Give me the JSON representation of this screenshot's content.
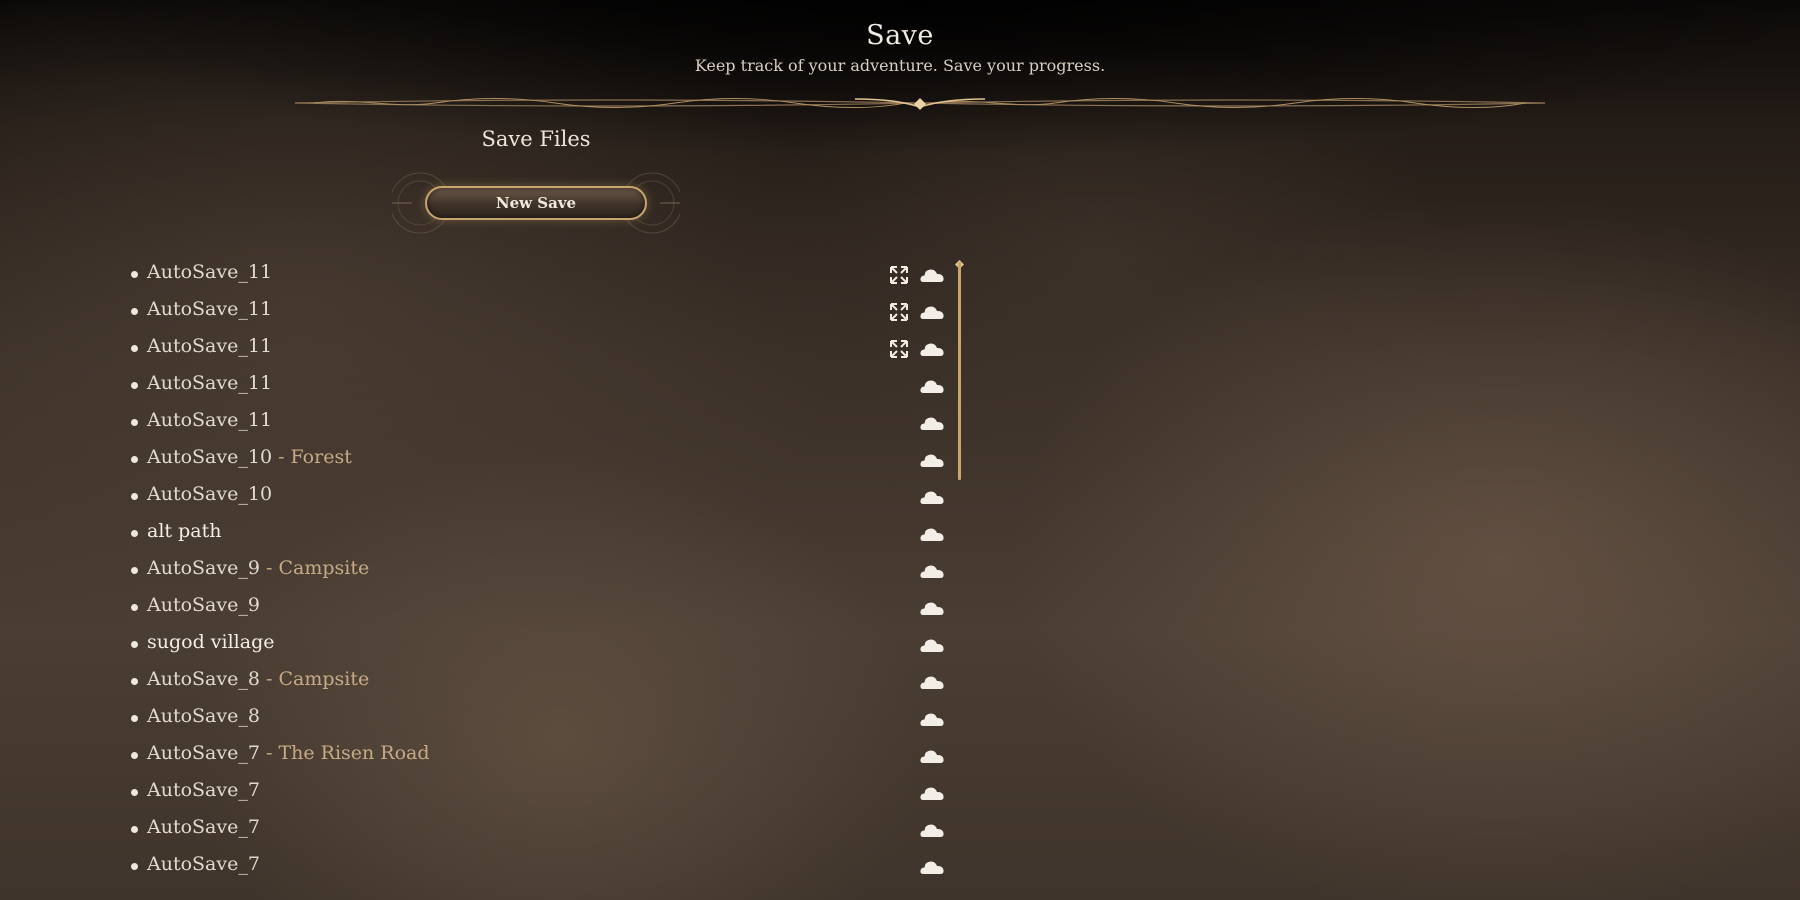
{
  "header": {
    "title": "Save",
    "subtitle": "Keep track of your adventure. Save your progress."
  },
  "save_files": {
    "section_title": "Save Files",
    "new_save_label": "New Save",
    "items": [
      {
        "name": "AutoSave_11",
        "location": "",
        "expand_icon": true,
        "cloud_icon": true,
        "kind": "auto"
      },
      {
        "name": "AutoSave_11",
        "location": "",
        "expand_icon": true,
        "cloud_icon": true,
        "kind": "auto"
      },
      {
        "name": "AutoSave_11",
        "location": "",
        "expand_icon": true,
        "cloud_icon": true,
        "kind": "auto"
      },
      {
        "name": "AutoSave_11",
        "location": "",
        "expand_icon": false,
        "cloud_icon": true,
        "kind": "auto"
      },
      {
        "name": "AutoSave_11",
        "location": "",
        "expand_icon": false,
        "cloud_icon": true,
        "kind": "auto"
      },
      {
        "name": "AutoSave_10",
        "location": " - Forest",
        "expand_icon": false,
        "cloud_icon": true,
        "kind": "auto"
      },
      {
        "name": "AutoSave_10",
        "location": "",
        "expand_icon": false,
        "cloud_icon": true,
        "kind": "auto"
      },
      {
        "name": "alt path",
        "location": "",
        "expand_icon": false,
        "cloud_icon": true,
        "kind": "user"
      },
      {
        "name": "AutoSave_9",
        "location": " - Campsite",
        "expand_icon": false,
        "cloud_icon": true,
        "kind": "auto"
      },
      {
        "name": "AutoSave_9",
        "location": "",
        "expand_icon": false,
        "cloud_icon": true,
        "kind": "auto"
      },
      {
        "name": "sugod village",
        "location": "",
        "expand_icon": false,
        "cloud_icon": true,
        "kind": "user"
      },
      {
        "name": "AutoSave_8",
        "location": " - Campsite",
        "expand_icon": false,
        "cloud_icon": true,
        "kind": "auto"
      },
      {
        "name": "AutoSave_8",
        "location": "",
        "expand_icon": false,
        "cloud_icon": true,
        "kind": "auto"
      },
      {
        "name": "AutoSave_7",
        "location": " - The Risen Road",
        "expand_icon": false,
        "cloud_icon": true,
        "kind": "auto"
      },
      {
        "name": "AutoSave_7",
        "location": "",
        "expand_icon": false,
        "cloud_icon": true,
        "kind": "auto"
      },
      {
        "name": "AutoSave_7",
        "location": "",
        "expand_icon": false,
        "cloud_icon": true,
        "kind": "auto"
      },
      {
        "name": "AutoSave_7",
        "location": "",
        "expand_icon": false,
        "cloud_icon": true,
        "kind": "auto"
      }
    ]
  },
  "icons": {
    "expand": "expand-arrows-icon",
    "cloud": "cloud-sync-icon"
  },
  "colors": {
    "accent_gold": "#c9a56e",
    "location_text": "#c7ab86",
    "text_primary": "#e3dacd"
  }
}
